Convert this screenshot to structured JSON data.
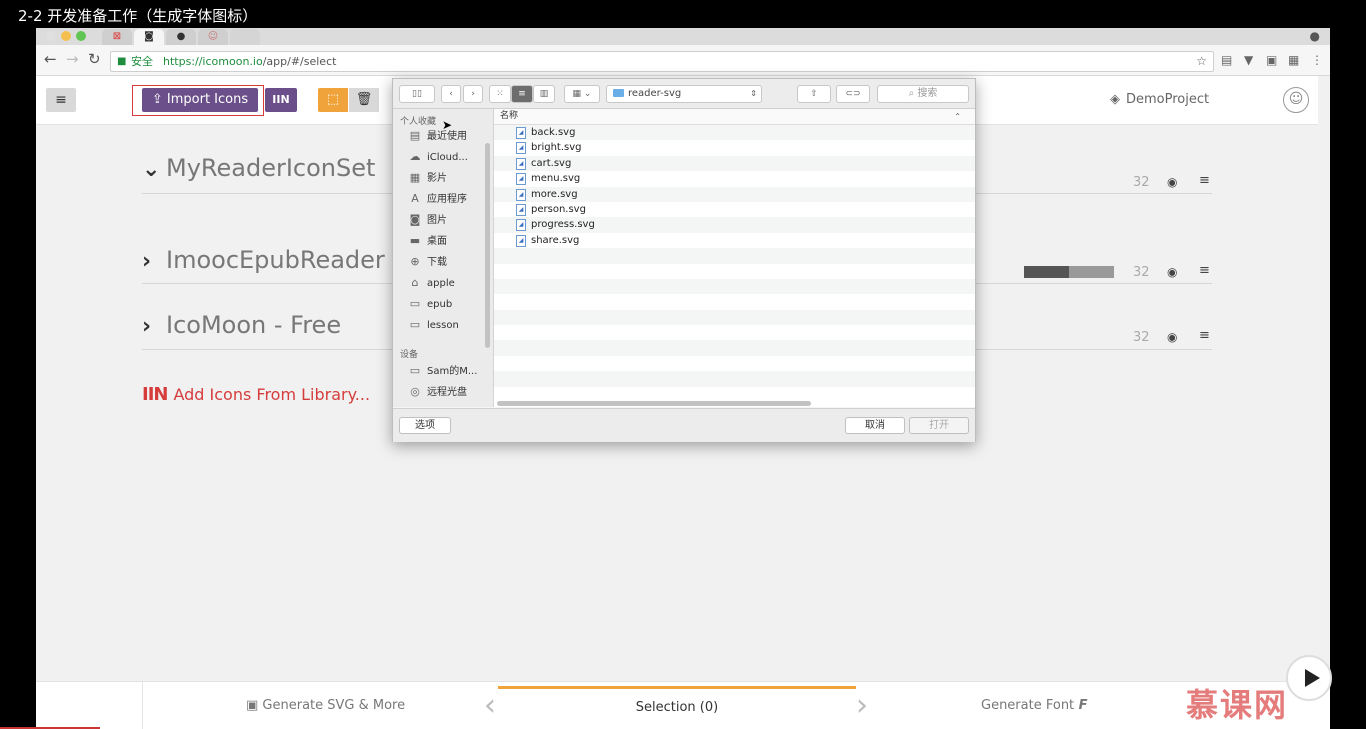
{
  "video": {
    "title": "2-2 开发准备工作（生成字体图标）",
    "watermark": "慕课网"
  },
  "browser": {
    "secure_label": "安全",
    "url_host": "https://icomoon.io",
    "url_path": "/app/#/select"
  },
  "header": {
    "import_label": "Import Icons",
    "library_label": "IIN",
    "project_name": "DemoProject"
  },
  "sets": [
    {
      "name": "MyReaderIconSet",
      "size": "32",
      "expanded": true
    },
    {
      "name": "ImoocEpubReader",
      "size": "32",
      "expanded": false,
      "progress": 0.5
    },
    {
      "name": "IcoMoon - Free",
      "size": "32",
      "expanded": false
    }
  ],
  "add_library": "Add Icons From Library...",
  "dialog": {
    "folder": "reader-svg",
    "search_placeholder": "搜索",
    "favorites_header": "个人收藏",
    "devices_header": "设备",
    "favorites": [
      {
        "label": "最近使用",
        "icon": "recent-icon"
      },
      {
        "label": "iCloud...",
        "icon": "cloud-icon"
      },
      {
        "label": "影片",
        "icon": "movies-icon"
      },
      {
        "label": "应用程序",
        "icon": "applications-icon"
      },
      {
        "label": "图片",
        "icon": "camera-icon"
      },
      {
        "label": "桌面",
        "icon": "desktop-icon"
      },
      {
        "label": "下载",
        "icon": "download-icon"
      },
      {
        "label": "apple",
        "icon": "home-icon"
      },
      {
        "label": "epub",
        "icon": "folder-icon"
      },
      {
        "label": "lesson",
        "icon": "folder-icon"
      }
    ],
    "devices": [
      {
        "label": "Sam的M...",
        "icon": "laptop-icon"
      },
      {
        "label": "远程光盘",
        "icon": "disc-icon"
      }
    ],
    "column_header": "名称",
    "files": [
      "back.svg",
      "bright.svg",
      "cart.svg",
      "menu.svg",
      "more.svg",
      "person.svg",
      "progress.svg",
      "share.svg"
    ],
    "options_label": "选项",
    "cancel_label": "取消",
    "open_label": "打开"
  },
  "bottom": {
    "left": "Generate SVG & More",
    "center": "Selection (0)",
    "right": "Generate Font"
  }
}
